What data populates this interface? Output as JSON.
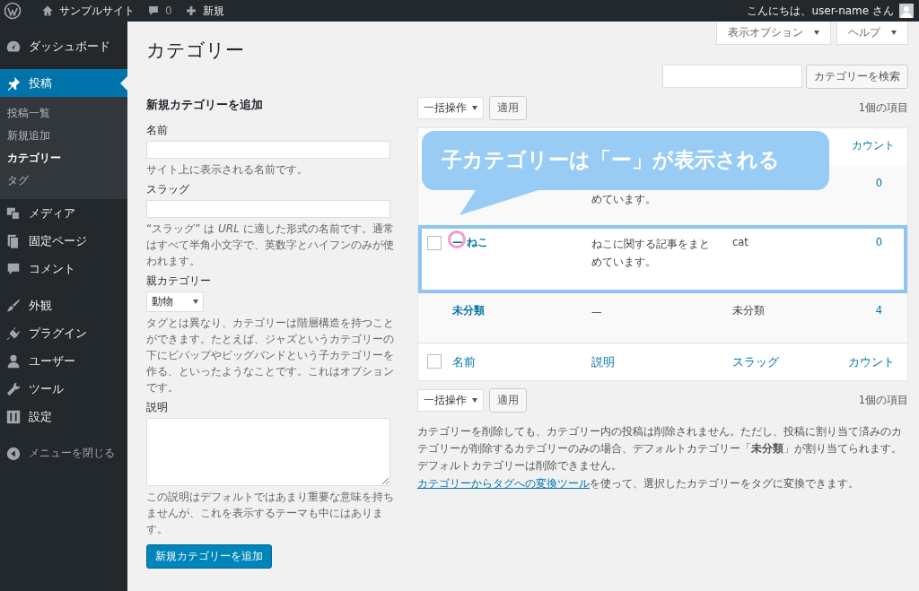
{
  "admin_bar": {
    "site_name": "サンプルサイト",
    "comments": "0",
    "new": "新規",
    "greeting": "こんにちは、user-name さん"
  },
  "sidebar": {
    "groups": [
      [
        {
          "label": "ダッシュボード",
          "selected": false
        }
      ],
      [
        {
          "label": "投稿",
          "selected": true,
          "children": [
            {
              "label": "投稿一覧",
              "selected": false
            },
            {
              "label": "新規追加",
              "selected": false
            },
            {
              "label": "カテゴリー",
              "selected": true
            },
            {
              "label": "タグ",
              "selected": false
            }
          ]
        },
        {
          "label": "メディア",
          "selected": false
        },
        {
          "label": "固定ページ",
          "selected": false
        },
        {
          "label": "コメント",
          "selected": false
        }
      ],
      [
        {
          "label": "外観",
          "selected": false
        },
        {
          "label": "プラグイン",
          "selected": false
        },
        {
          "label": "ユーザー",
          "selected": false
        },
        {
          "label": "ツール",
          "selected": false
        },
        {
          "label": "設定",
          "selected": false
        }
      ]
    ],
    "collapse": "メニューを閉じる"
  },
  "screen_options": "表示オプション",
  "help": "ヘルプ",
  "page_title": "カテゴリー",
  "add_form": {
    "heading": "新規カテゴリーを追加",
    "fields": [
      {
        "kind": "text",
        "label": "名前",
        "hint": "サイト上に表示される名前です。"
      },
      {
        "kind": "text",
        "label": "スラッグ",
        "hint": "“スラッグ” は *URL* に適した形式の名前です。通常はすべて半角小文字で、英数字とハイフンのみが使われます。"
      },
      {
        "kind": "select",
        "label": "親カテゴリー",
        "value": "動物",
        "hint": "タグとは異なり、カテゴリーは階層構造を持つことができます。たとえば、ジャズというカテゴリーの下にビバップやビッグバンドという子カテゴリーを作る、といったようなことです。これはオプションです。"
      },
      {
        "kind": "textarea",
        "label": "説明",
        "hint": "この説明はデフォルトではあまり重要な意味を持ちませんが、これを表示するテーマも中にはあります。"
      }
    ],
    "submit": "新規カテゴリーを追加"
  },
  "search_button": "カテゴリーを検索",
  "table": {
    "top_nav": {
      "bulk_action": "一括操作",
      "apply": "適用",
      "item_count": "1個の項目"
    },
    "header_count": "カウント",
    "rows": [
      {
        "description": "めています。",
        "count": "0",
        "highlighted": false
      },
      {
        "has_checkbox": true,
        "name": "— ねこ",
        "description": "ねこに関する記事をまとめています。",
        "slug": "cat",
        "count": "0",
        "highlighted": true
      },
      {
        "has_checkbox": false,
        "name": "未分類",
        "description": "—",
        "slug": "未分類",
        "count": "4",
        "highlighted": false
      }
    ],
    "footer": [
      "名前",
      "説明",
      "スラッグ",
      "カウント"
    ],
    "select_all_checked": false,
    "bottom_nav": {
      "bulk_action": "一括操作",
      "apply": "適用",
      "item_count": "1個の項目"
    }
  },
  "callout": "子カテゴリーは「ー」が表示される",
  "notes": {
    "text": "カテゴリーを削除しても、カテゴリー内の投稿は削除されません。ただし、投稿に割り当て済みのカテゴリーが削除するカテゴリーのみの場合、デフォルトカテゴリー「**未分類**」が割り当てられます。デフォルトカテゴリーは削除できません。",
    "link": "カテゴリーからタグへの変換ツール",
    "after_link": "を使って、選択したカテゴリーをタグに変換できます。"
  }
}
